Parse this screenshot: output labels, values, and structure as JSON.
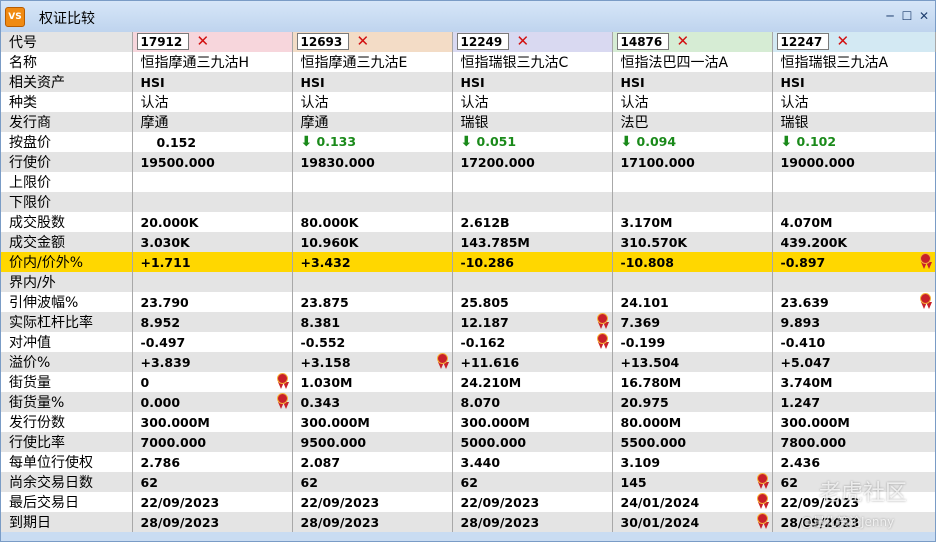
{
  "window": {
    "title": "权证比较",
    "app_icon_text": "VS"
  },
  "codes": [
    "17912",
    "12693",
    "12249",
    "14876",
    "12247"
  ],
  "code_header_colors": [
    "#f7d6dc",
    "#f3dcc6",
    "#d9d9f1",
    "#d6ecd4",
    "#d3e9f3"
  ],
  "rows": [
    {
      "label": "名称",
      "style": "txt",
      "values": [
        "恒指摩通三九沽H",
        "恒指摩通三九沽E",
        "恒指瑞银三九沽C",
        "恒指法巴四一沽A",
        "恒指瑞银三九沽A"
      ]
    },
    {
      "label": "相关资产",
      "style": "val",
      "values": [
        "HSI",
        "HSI",
        "HSI",
        "HSI",
        "HSI"
      ]
    },
    {
      "label": "种类",
      "style": "txt",
      "values": [
        "认沽",
        "认沽",
        "认沽",
        "认沽",
        "认沽"
      ]
    },
    {
      "label": "发行商",
      "style": "txt",
      "values": [
        "摩通",
        "摩通",
        "瑞银",
        "法巴",
        "瑞银"
      ]
    },
    {
      "label": "按盘价",
      "style": "val",
      "values": [
        "0.152",
        "0.133",
        "0.051",
        "0.094",
        "0.102"
      ],
      "down": [
        false,
        true,
        true,
        true,
        true
      ]
    },
    {
      "label": "行使价",
      "style": "val",
      "values": [
        "19500.000",
        "19830.000",
        "17200.000",
        "17100.000",
        "19000.000"
      ]
    },
    {
      "label": "上限价",
      "style": "val",
      "values": [
        "",
        "",
        "",
        "",
        ""
      ]
    },
    {
      "label": "下限价",
      "style": "val",
      "values": [
        "",
        "",
        "",
        "",
        ""
      ]
    },
    {
      "label": "成交股数",
      "style": "val",
      "values": [
        "20.000K",
        "80.000K",
        "2.612B",
        "3.170M",
        "4.070M"
      ]
    },
    {
      "label": "成交金额",
      "style": "val",
      "values": [
        "3.030K",
        "10.960K",
        "143.785M",
        "310.570K",
        "439.200K"
      ]
    },
    {
      "label": "价内/价外%",
      "style": "val",
      "values": [
        "+1.711",
        "+3.432",
        "-10.286",
        "-10.808",
        "-0.897"
      ],
      "highlight": true,
      "badges": [
        false,
        false,
        false,
        false,
        true
      ]
    },
    {
      "label": "界内/外",
      "style": "val",
      "values": [
        "",
        "",
        "",
        "",
        ""
      ]
    },
    {
      "label": "引伸波幅%",
      "style": "val",
      "values": [
        "23.790",
        "23.875",
        "25.805",
        "24.101",
        "23.639"
      ],
      "badges": [
        false,
        false,
        false,
        false,
        true
      ]
    },
    {
      "label": "实际杠杆比率",
      "style": "val",
      "values": [
        "8.952",
        "8.381",
        "12.187",
        "7.369",
        "9.893"
      ],
      "badges": [
        false,
        false,
        true,
        false,
        false
      ]
    },
    {
      "label": "对冲值",
      "style": "val",
      "values": [
        "-0.497",
        "-0.552",
        "-0.162",
        "-0.199",
        "-0.410"
      ],
      "badges": [
        false,
        false,
        true,
        false,
        false
      ]
    },
    {
      "label": "溢价%",
      "style": "val",
      "values": [
        "+3.839",
        "+3.158",
        "+11.616",
        "+13.504",
        "+5.047"
      ],
      "badges": [
        false,
        true,
        false,
        false,
        false
      ]
    },
    {
      "label": "街货量",
      "style": "val",
      "values": [
        "0",
        "1.030M",
        "24.210M",
        "16.780M",
        "3.740M"
      ],
      "badges": [
        true,
        false,
        false,
        false,
        false
      ]
    },
    {
      "label": "街货量%",
      "style": "val",
      "values": [
        "0.000",
        "0.343",
        "8.070",
        "20.975",
        "1.247"
      ],
      "badges": [
        true,
        false,
        false,
        false,
        false
      ]
    },
    {
      "label": "发行份数",
      "style": "val",
      "values": [
        "300.000M",
        "300.000M",
        "300.000M",
        "80.000M",
        "300.000M"
      ]
    },
    {
      "label": "行使比率",
      "style": "val",
      "values": [
        "7000.000",
        "9500.000",
        "5000.000",
        "5500.000",
        "7800.000"
      ]
    },
    {
      "label": "每单位行使权",
      "style": "val",
      "values": [
        "2.786",
        "2.087",
        "3.440",
        "3.109",
        "2.436"
      ]
    },
    {
      "label": "尚余交易日数",
      "style": "val",
      "values": [
        "62",
        "62",
        "62",
        "145",
        "62"
      ],
      "badges": [
        false,
        false,
        false,
        true,
        false
      ]
    },
    {
      "label": "最后交易日",
      "style": "val",
      "values": [
        "22/09/2023",
        "22/09/2023",
        "22/09/2023",
        "24/01/2024",
        "22/09/2023"
      ],
      "badges": [
        false,
        false,
        false,
        true,
        false
      ]
    },
    {
      "label": "到期日",
      "style": "val",
      "values": [
        "28/09/2023",
        "28/09/2023",
        "28/09/2023",
        "30/01/2024",
        "28/09/2023"
      ],
      "badges": [
        false,
        false,
        false,
        true,
        false
      ]
    }
  ],
  "header_label": "代号",
  "watermark": {
    "main": "老虎社区",
    "sub": "@量化策论Jenny"
  },
  "colors": {
    "highlight_row": "#ffd700",
    "down_arrow": "#1a8a1a",
    "remove_x": "#d21010",
    "badge": "#c8202a"
  }
}
